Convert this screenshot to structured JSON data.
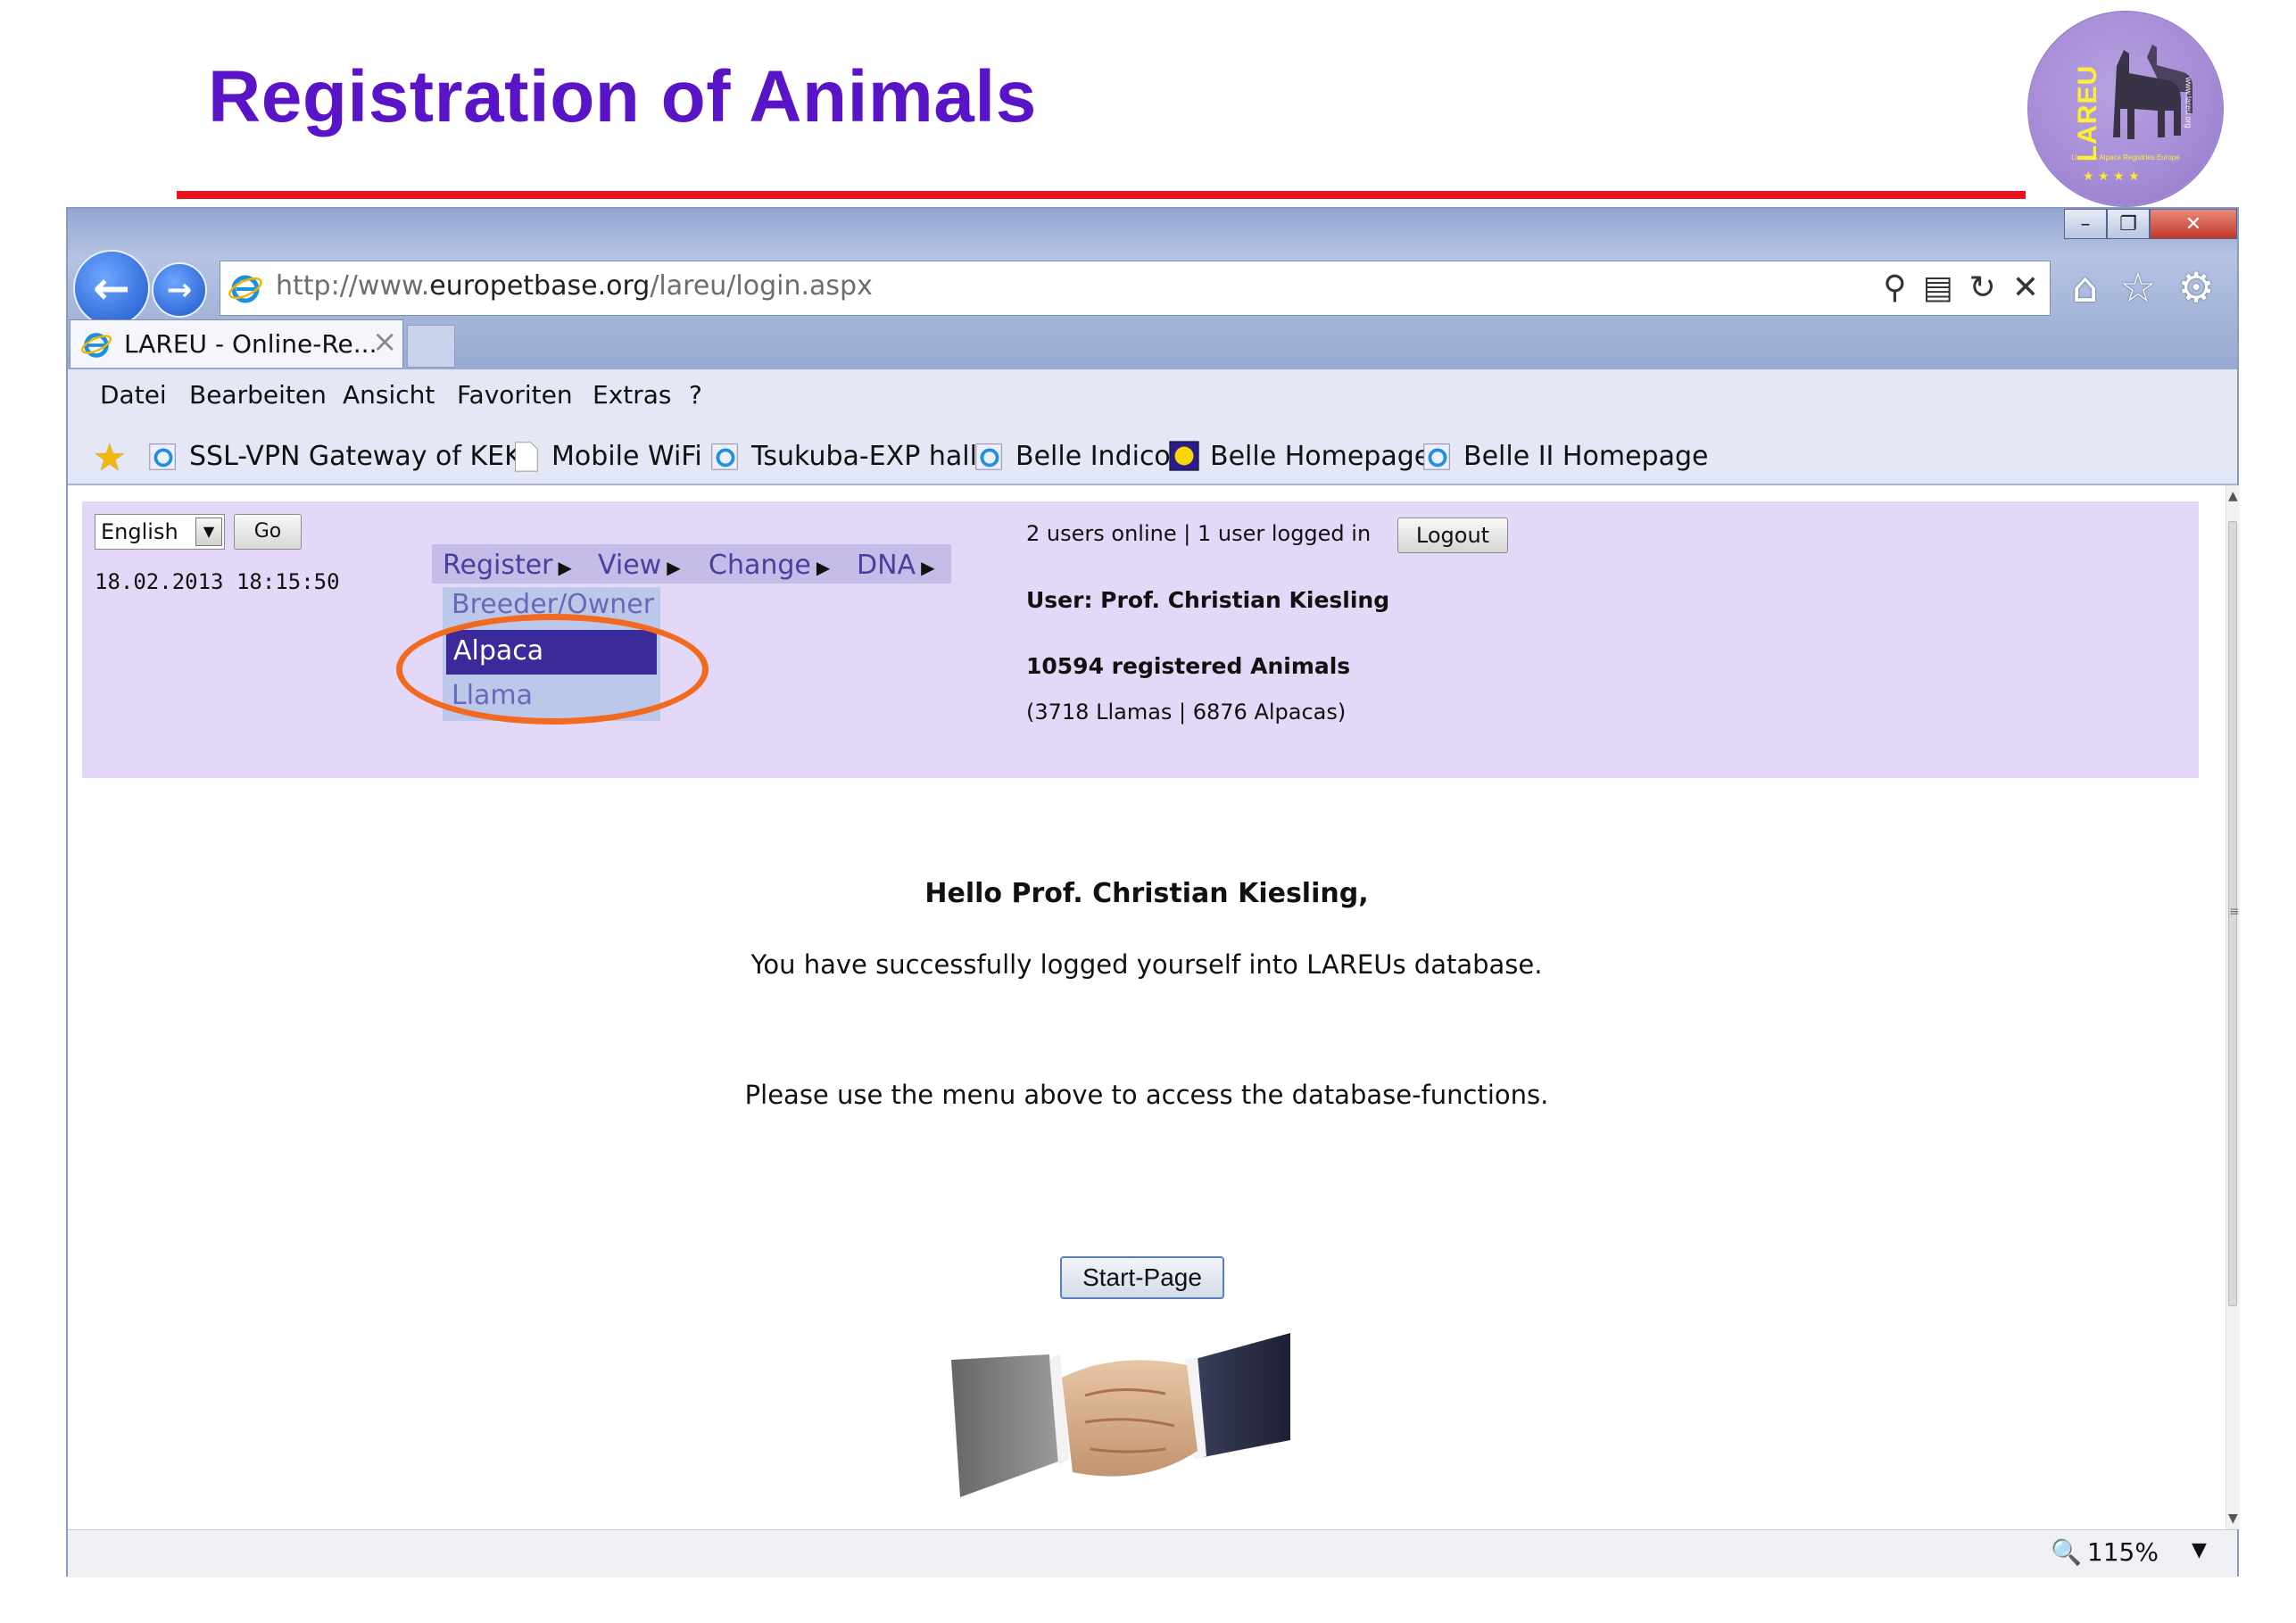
{
  "slide": {
    "title": "Registration of Animals",
    "logo": {
      "word": "LAREU",
      "subtitle": "Llama & Alpaca Registries Europe",
      "url": "www.lareu.org"
    }
  },
  "browser": {
    "window_buttons": {
      "minimize": "–",
      "restore": "❐",
      "close": "✕"
    },
    "address": {
      "prefix": "http://www.",
      "domain": "europetbase.org",
      "path": "/lareu/login.aspx"
    },
    "tab": {
      "label": "LAREU - Online-Re...",
      "close": "×"
    },
    "menu": [
      "Datei",
      "Bearbeiten",
      "Ansicht",
      "Favoriten",
      "Extras",
      "?"
    ],
    "favorites": [
      "SSL-VPN Gateway of KEK",
      "Mobile WiFi",
      "Tsukuba-EXP hall",
      "Belle Indico",
      "Belle Homepage",
      "Belle II Homepage"
    ],
    "zoom": "115%"
  },
  "page": {
    "language": "English",
    "go_label": "Go",
    "datetime": "18.02.2013 18:15:50",
    "nav": [
      "Register",
      "View",
      "Change",
      "DNA"
    ],
    "submenu": [
      "Breeder/Owner",
      "Alpaca",
      "Llama"
    ],
    "submenu_selected": "Alpaca",
    "users_online": "2 users online",
    "separator": "|",
    "users_logged": "1 user logged in",
    "logout_label": "Logout",
    "user_line": "User: Prof. Christian Kiesling",
    "registered": "10594 registered Animals",
    "breakdown": "(3718 Llamas | 6876 Alpacas)",
    "greeting": "Hello Prof. Christian Kiesling,",
    "success_msg": "You have successfully logged yourself into LAREUs database.",
    "menu_hint": "Please use the menu above to access the database-functions.",
    "start_button": "Start-Page"
  },
  "colors": {
    "title": "#5a14c8",
    "rule": "#e8141e",
    "panel": "#e3d8f8",
    "selected": "#3b2b9a",
    "ring": "#f26a1f"
  }
}
